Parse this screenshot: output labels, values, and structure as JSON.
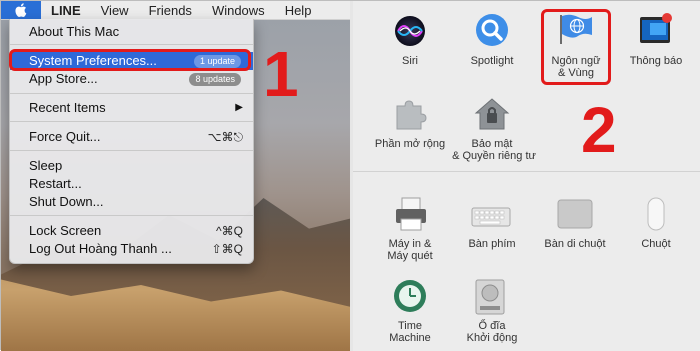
{
  "menubar": {
    "app_name": "LINE",
    "menus": [
      "View",
      "Friends",
      "Windows",
      "Help"
    ]
  },
  "apple_menu": {
    "items": [
      {
        "label": "About This Mac"
      },
      {
        "label": "System Preferences...",
        "badge": "1 update",
        "highlighted": true
      },
      {
        "label": "App Store...",
        "badge": "8 updates"
      },
      {
        "label": "Recent Items",
        "submenu": true
      },
      {
        "label": "Force Quit...",
        "shortcut": "⌥⌘⎋"
      },
      {
        "label": "Sleep"
      },
      {
        "label": "Restart..."
      },
      {
        "label": "Shut Down..."
      },
      {
        "label": "Lock Screen",
        "shortcut": "^⌘Q"
      },
      {
        "label": "Log Out Hoàng Thanh ...",
        "shortcut": "⇧⌘Q"
      }
    ]
  },
  "annotations": {
    "step1": "1",
    "step2": "2"
  },
  "preferences": {
    "row1": [
      {
        "label": "Siri",
        "icon": "siri-icon"
      },
      {
        "label": "Spotlight",
        "icon": "spotlight-icon"
      },
      {
        "label": "Ngôn ngữ\n& Vùng",
        "label_line1": "Ngôn ngữ",
        "label_line2": "& Vùng",
        "icon": "language-region-icon"
      },
      {
        "label": "Thông báo",
        "icon": "notifications-icon"
      }
    ],
    "row2": [
      {
        "label": "Phần mở rộng",
        "icon": "extensions-icon"
      },
      {
        "label_line1": "Bảo mật",
        "label_line2": "& Quyền riêng tư",
        "icon": "security-privacy-icon"
      }
    ],
    "row3": [
      {
        "label_line1": "Máy in &",
        "label_line2": "Máy quét",
        "icon": "printer-icon"
      },
      {
        "label": "Bàn phím",
        "icon": "keyboard-icon"
      },
      {
        "label": "Bàn di chuột",
        "icon": "trackpad-icon"
      },
      {
        "label": "Chuột",
        "icon": "mouse-icon"
      }
    ],
    "row4": [
      {
        "label_line1": "Time",
        "label_line2": "Machine",
        "icon": "time-machine-icon"
      },
      {
        "label_line1": "Ổ đĩa",
        "label_line2": "Khởi động",
        "icon": "startup-disk-icon"
      }
    ]
  },
  "colors": {
    "highlight": "#2f69d8",
    "annotation": "#e21b1b"
  }
}
